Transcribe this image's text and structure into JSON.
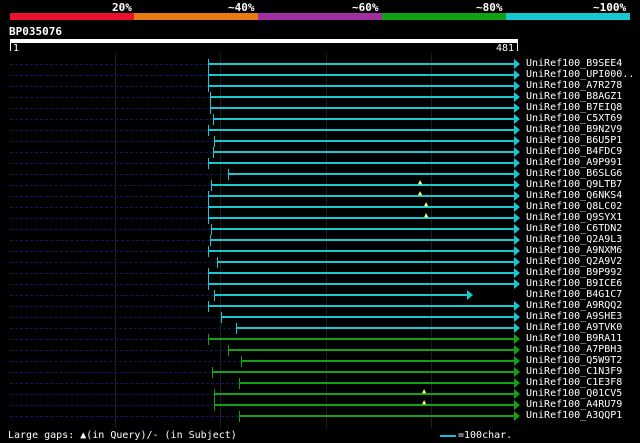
{
  "legend": {
    "labels": [
      "20%",
      "~40%",
      "~60%",
      "~80%",
      "~100%"
    ],
    "colors": [
      "#e8102a",
      "#e87a18",
      "#a030a0",
      "#13a013",
      "#18c8d0"
    ]
  },
  "query": {
    "id": "BP035076",
    "start": "1",
    "end": "481"
  },
  "hits": [
    {
      "name": "UniRef100_B9SEE4",
      "color": "cyan"
    },
    {
      "name": "UniRef100_UPI000..",
      "color": "cyan"
    },
    {
      "name": "UniRef100_A7R278",
      "color": "cyan"
    },
    {
      "name": "UniRef100_B8AGZ1",
      "color": "cyan"
    },
    {
      "name": "UniRef100_B7EIQ8",
      "color": "cyan"
    },
    {
      "name": "UniRef100_C5XT69",
      "color": "cyan"
    },
    {
      "name": "UniRef100_B9N2V9",
      "color": "cyan"
    },
    {
      "name": "UniRef100_B6U5P1",
      "color": "cyan"
    },
    {
      "name": "UniRef100_B4FDC9",
      "color": "cyan"
    },
    {
      "name": "UniRef100_A9P991",
      "color": "cyan"
    },
    {
      "name": "UniRef100_B6SLG6",
      "color": "cyan"
    },
    {
      "name": "UniRef100_Q9LTB7",
      "color": "cyan"
    },
    {
      "name": "UniRef100_Q6NKS4",
      "color": "cyan"
    },
    {
      "name": "UniRef100_Q8LC02",
      "color": "cyan"
    },
    {
      "name": "UniRef100_Q9SYX1",
      "color": "cyan"
    },
    {
      "name": "UniRef100_C6TDN2",
      "color": "cyan"
    },
    {
      "name": "UniRef100_Q2A9L3",
      "color": "cyan"
    },
    {
      "name": "UniRef100_A9NXM6",
      "color": "cyan"
    },
    {
      "name": "UniRef100_Q2A9V2",
      "color": "cyan"
    },
    {
      "name": "UniRef100_B9P992",
      "color": "cyan"
    },
    {
      "name": "UniRef100_B9ICE6",
      "color": "cyan"
    },
    {
      "name": "UniRef100_B4G1C7",
      "color": "cyan"
    },
    {
      "name": "UniRef100_A9RQQ2",
      "color": "cyan"
    },
    {
      "name": "UniRef100_A9SHE3",
      "color": "cyan"
    },
    {
      "name": "UniRef100_A9TVK0",
      "color": "cyan"
    },
    {
      "name": "UniRef100_B9RA11",
      "color": "green"
    },
    {
      "name": "UniRef100_A7PBH3",
      "color": "green"
    },
    {
      "name": "UniRef100_Q5W9T2",
      "color": "green"
    },
    {
      "name": "UniRef100_C1N3F9",
      "color": "green"
    },
    {
      "name": "UniRef100_C1E3F8",
      "color": "green"
    },
    {
      "name": "UniRef100_Q01CV5",
      "color": "green"
    },
    {
      "name": "UniRef100_A4RU79",
      "color": "green"
    },
    {
      "name": "UniRef100_A3QQP1",
      "color": "green"
    }
  ],
  "footer": {
    "gaps_text": "Large gaps: ▲(in Query)/- (in Subject)",
    "scale_text": "=100char."
  }
}
